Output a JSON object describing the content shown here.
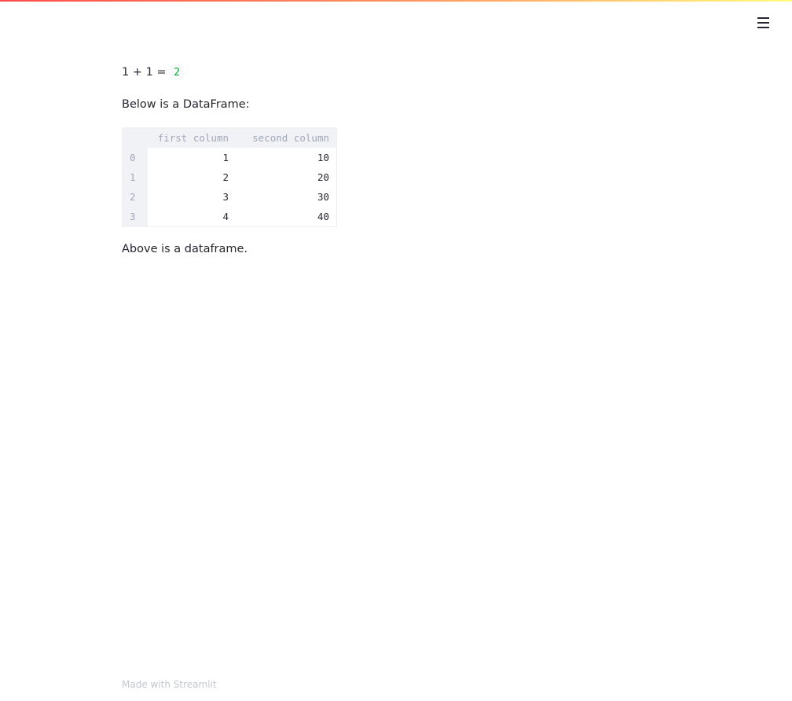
{
  "header": {
    "menu_icon": "hamburger-icon"
  },
  "content": {
    "formula_text": "1 + 1 = ",
    "formula_result": "2",
    "intro_text": "Below is a DataFrame:",
    "outro_text": "Above is a dataframe."
  },
  "dataframe": {
    "columns": [
      "first column",
      "second column"
    ],
    "rows": [
      {
        "index": "0",
        "first": "1",
        "second": "10"
      },
      {
        "index": "1",
        "first": "2",
        "second": "20"
      },
      {
        "index": "2",
        "first": "3",
        "second": "30"
      },
      {
        "index": "3",
        "first": "4",
        "second": "40"
      }
    ]
  },
  "footer": {
    "text": "Made with Streamlit"
  },
  "colors": {
    "accent_gradient_start": "#ff4b4b",
    "accent_gradient_end": "#fffd80",
    "code_green": "#09ab3b"
  }
}
